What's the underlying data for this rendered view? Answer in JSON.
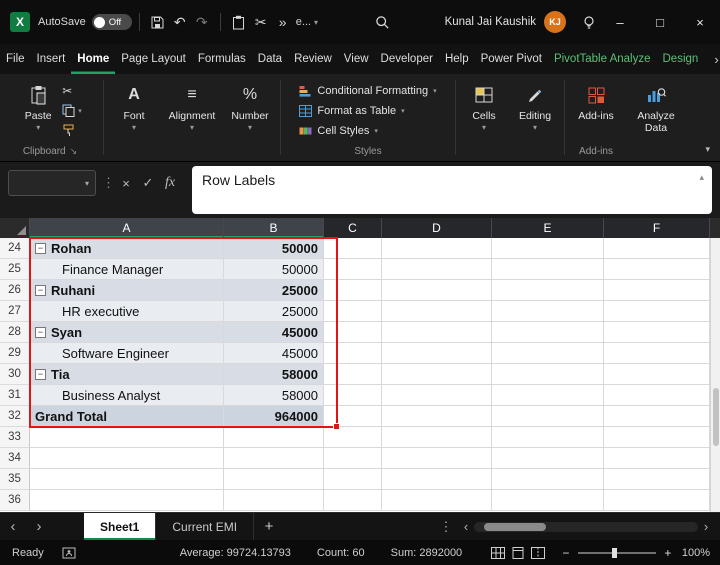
{
  "titlebar": {
    "autosave": "AutoSave",
    "autosave_state": "Off",
    "qat_overflow": "e...",
    "user_name": "Kunal Jai Kaushik",
    "user_initials": "KJ"
  },
  "menubar": {
    "items": [
      "File",
      "Insert",
      "Home",
      "Page Layout",
      "Formulas",
      "Data",
      "Review",
      "View",
      "Developer",
      "Help",
      "Power Pivot",
      "PivotTable Analyze",
      "Design"
    ]
  },
  "ribbon": {
    "paste": "Paste",
    "clipboard_group": "Clipboard",
    "font": "Font",
    "alignment": "Alignment",
    "number": "Number",
    "conditional_formatting": "Conditional Formatting",
    "format_as_table": "Format as Table",
    "cell_styles": "Cell Styles",
    "styles_group": "Styles",
    "cells": "Cells",
    "editing": "Editing",
    "addins": "Add-ins",
    "addins_group": "Add-ins",
    "analyze_data": "Analyze Data"
  },
  "formula_bar": {
    "content": "Row Labels",
    "fx": "fx"
  },
  "grid": {
    "columns": [
      "A",
      "B",
      "C",
      "D",
      "E",
      "F"
    ],
    "rows": [
      {
        "num": "24",
        "label": "Rohan",
        "value": "50000"
      },
      {
        "num": "25",
        "label": "Finance Manager",
        "value": "50000"
      },
      {
        "num": "26",
        "label": "Ruhani",
        "value": "25000"
      },
      {
        "num": "27",
        "label": "HR executive",
        "value": "25000"
      },
      {
        "num": "28",
        "label": "Syan",
        "value": "45000"
      },
      {
        "num": "29",
        "label": "Software Engineer",
        "value": "45000"
      },
      {
        "num": "30",
        "label": "Tia",
        "value": "58000"
      },
      {
        "num": "31",
        "label": "Business Analyst",
        "value": "58000"
      },
      {
        "num": "32",
        "label": "Grand Total",
        "value": "964000"
      },
      {
        "num": "33",
        "label": "",
        "value": ""
      },
      {
        "num": "34",
        "label": "",
        "value": ""
      },
      {
        "num": "35",
        "label": "",
        "value": ""
      },
      {
        "num": "36",
        "label": "",
        "value": ""
      }
    ]
  },
  "sheet_tabs": {
    "tabs": [
      "Sheet1",
      "Current EMI"
    ]
  },
  "statusbar": {
    "ready": "Ready",
    "average": "Average: 99724.13793",
    "count": "Count: 60",
    "sum": "Sum: 2892000",
    "zoom": "100%"
  },
  "colors": {
    "excel_green": "#107c41",
    "tab_underline": "#21a366",
    "contextual_tab": "#5fbf77",
    "selection_red": "#e21414",
    "avatar_orange": "#d9731a",
    "pivot_subtotal_shade": "#d8dde5",
    "pivot_detail_shade": "#e9ecf1",
    "pivot_grand_shade": "#ccd4df"
  },
  "icons": {
    "excel": "X",
    "minus": "−",
    "dropdown": "▾",
    "collapse_up": "▴",
    "undo": "↶",
    "redo": "↷",
    "scissors": "✂",
    "more": "»",
    "prev": "‹",
    "next": "›",
    "dots": "⋮",
    "cancel": "×",
    "check": "✓",
    "add": "+",
    "minimize": "–",
    "maximize": "□",
    "close": "×",
    "more_tabs": "›",
    "font_a": "A",
    "align": "≡",
    "number_pct": "%",
    "launcher": "↘",
    "zoom_out": "−",
    "zoom_in": "+"
  }
}
